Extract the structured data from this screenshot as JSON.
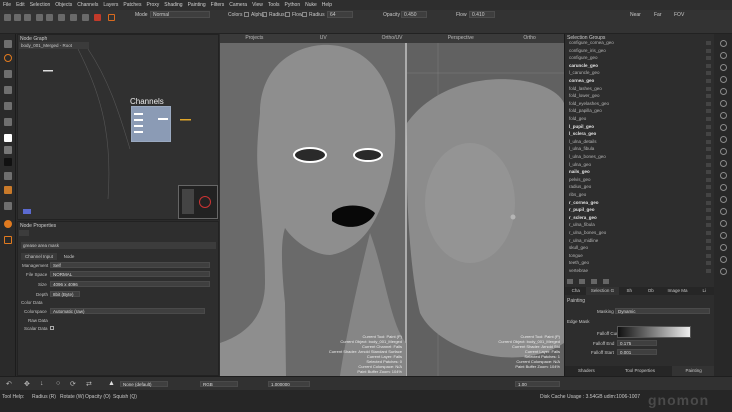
{
  "menu": [
    "File",
    "Edit",
    "Selection",
    "Objects",
    "Channels",
    "Layers",
    "Patches",
    "Proxy",
    "Shading",
    "Painting",
    "Filters",
    "Camera",
    "View",
    "Tools",
    "Python",
    "Nuke",
    "Help"
  ],
  "toolbar": {
    "mode_label": "Mode",
    "mode_value": "Normal",
    "colors_label": "Colors",
    "alpha_label": "Alpha",
    "radius_label": "Radius",
    "flow_label": "Flow",
    "radius2_label": "Radius",
    "radius2_value": "64",
    "opacity_label": "Opacity",
    "opacity_value": "0.450",
    "flow2_label": "Flow",
    "flow2_value": "0.410",
    "near_label": "Near",
    "far_label": "Far",
    "fov_label": "FOV"
  },
  "node_graph": {
    "title": "Node Graph",
    "breadcrumb": "body_001_Merged - Root",
    "channels_label": "Channels"
  },
  "node_props": {
    "title": "Node Properties",
    "node_name": "grease area mask",
    "tabs": [
      "Channel Input",
      "Node"
    ],
    "rows": [
      {
        "label": "Management",
        "value": "Self"
      },
      {
        "label": "File Space",
        "value": "NORMAL"
      },
      {
        "label": "Size",
        "value": "4096 x 4096"
      },
      {
        "label": "Depth",
        "value": "8bit (Byte)"
      }
    ],
    "color_data": {
      "section": "Color Data",
      "colorspace_label": "Colorspace",
      "colorspace_value": "Automatic (raw)",
      "raw_label": "Raw Data",
      "scalar_label": "Scalar Data"
    }
  },
  "viewport": {
    "tabs": [
      "Projects",
      "UV",
      "Ortho/UV",
      "Perspective",
      "Ortho"
    ],
    "info": [
      "Current Tool: Paint (P)",
      "Current Object: body_001_Merged",
      "Current Channel: Falls",
      "Current Shader: Arnold Standard Surface",
      "Current Layer: Falls",
      "Selected Patches: 0",
      "Current Colorspace: N/A",
      "Paint Buffer Zoom: 104%"
    ],
    "info2": [
      "Current Tool: Paint (P)",
      "Current Object: body_001_Merged",
      "Current Shader: Arnold Std",
      "Current Layer: Falls",
      "Selected Patches: 1",
      "Current Colorspace: N/A",
      "Paint Buffer Zoom: 104%"
    ]
  },
  "selection_groups": {
    "title": "Selection Groups",
    "items": [
      {
        "name": "configure_cornea_geo",
        "bold": false
      },
      {
        "name": "configure_iris_geo",
        "bold": false
      },
      {
        "name": "configure_geo",
        "bold": false
      },
      {
        "name": "caruncle_geo",
        "bold": true
      },
      {
        "name": "l_caruncle_geo",
        "bold": false
      },
      {
        "name": "cornea_geo",
        "bold": true
      },
      {
        "name": "fold_lashes_geo",
        "bold": false
      },
      {
        "name": "fold_lower_geo",
        "bold": false
      },
      {
        "name": "fold_eyelashes_geo",
        "bold": false
      },
      {
        "name": "fold_papilla_geo",
        "bold": false
      },
      {
        "name": "fold_geo",
        "bold": false
      },
      {
        "name": "l_pupil_geo",
        "bold": true
      },
      {
        "name": "l_sclera_geo",
        "bold": true
      },
      {
        "name": "l_ulna_details",
        "bold": false
      },
      {
        "name": "l_ulna_fibula",
        "bold": false
      },
      {
        "name": "l_ulna_bones_geo",
        "bold": false
      },
      {
        "name": "l_ulna_geo",
        "bold": false
      },
      {
        "name": "nails_geo",
        "bold": true
      },
      {
        "name": "pelvis_geo",
        "bold": false
      },
      {
        "name": "radius_geo",
        "bold": false
      },
      {
        "name": "ribs_geo",
        "bold": false
      },
      {
        "name": "r_cornea_geo",
        "bold": true
      },
      {
        "name": "r_pupil_geo",
        "bold": true
      },
      {
        "name": "r_sclera_geo",
        "bold": true
      },
      {
        "name": "r_ulna_fibula",
        "bold": false
      },
      {
        "name": "r_ulna_bones_geo",
        "bold": false
      },
      {
        "name": "r_ulna_midline",
        "bold": false
      },
      {
        "name": "skull_geo",
        "bold": false
      },
      {
        "name": "tongue",
        "bold": false
      },
      {
        "name": "teeth_geo",
        "bold": false
      },
      {
        "name": "vertebrae",
        "bold": false
      }
    ],
    "tabs": [
      "Cha",
      "Selection G",
      "Sh",
      "Ob",
      "Image Ma",
      "Li"
    ]
  },
  "painting": {
    "title": "Painting",
    "masking_label": "Masking",
    "masking_value": "Dynamic",
    "edge_mask": "Edge Mask",
    "falloff_curve": "Falloff Curve",
    "falloff_end_label": "Falloff End",
    "falloff_end_value": "0.175",
    "falloff_start_label": "Falloff Start",
    "falloff_start_value": "0.001",
    "bottom_tabs": [
      "Shaders",
      "Tool Properties",
      "Painting"
    ]
  },
  "bottombar": {
    "blend": "None (default)",
    "colorspace": "RGB",
    "zoom": "1.000000",
    "value": "1.00"
  },
  "statusbar": {
    "left": "Tool Help:",
    "items": [
      "Radius (R)",
      "Rotate (W)",
      "Opacity (O)",
      "Squish (Q)"
    ],
    "cache": "Disk Cache Usage : 3.54GB udim:1006-1007",
    "watermark": "gnomon"
  },
  "colors": {
    "accent": "#e07a1f",
    "viewport_bg": "#6b6b6b",
    "head": "#8e8e8e"
  }
}
